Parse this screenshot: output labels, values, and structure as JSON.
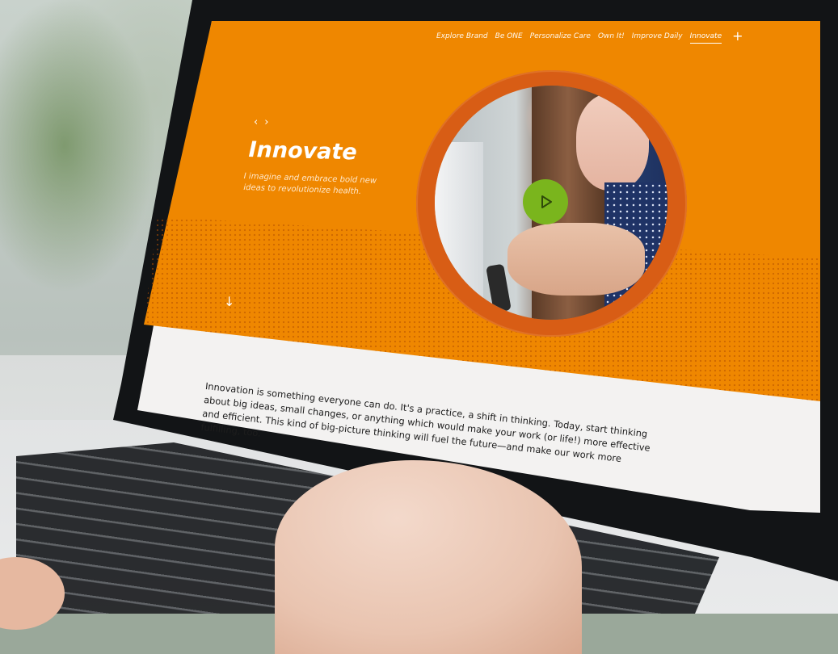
{
  "nav": {
    "items": [
      "Explore Brand",
      "Be ONE",
      "Personalize Care",
      "Own It!",
      "Improve Daily",
      "Innovate"
    ],
    "active": "Innovate",
    "plus": "+"
  },
  "hero": {
    "prev_arrow": "‹",
    "next_arrow": "›",
    "title": "Innovate",
    "subtitle": "I imagine and embrace bold new ideas to revolutionize health.",
    "down_arrow": "↓"
  },
  "body": {
    "text": "Innovation is something everyone can do. It's a practice, a shift in thinking. Today, start thinking about big ideas, small changes, or anything which would make your work (or life!) more effective and efficient. This kind of big-picture thinking will fuel the future—and make our work more fulfilling, too."
  },
  "colors": {
    "brand_orange": "#ef8700",
    "ring_orange": "#d85d15",
    "play_green": "#7ab51d"
  },
  "icons": {
    "play": "play-icon",
    "plus": "plus-icon",
    "down": "arrow-down-icon"
  }
}
